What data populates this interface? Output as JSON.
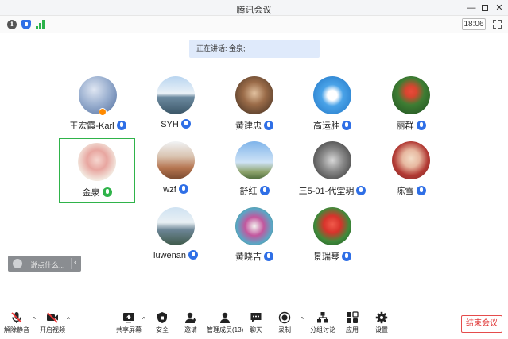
{
  "window": {
    "title": "腾讯会议",
    "minimize_glyph": "—",
    "close_glyph": "✕"
  },
  "status": {
    "info_glyph": "i",
    "time": "18:06",
    "icons": [
      "info-icon",
      "shield-icon",
      "signal-icon",
      "fullscreen-icon"
    ],
    "signal_color": "#2bb34a",
    "shield_color": "#2f6fe6"
  },
  "speaking": {
    "text": "正在讲话: 金泉;"
  },
  "participants": [
    {
      "name": "王宏霞-Karl",
      "mic": "blue",
      "host": true
    },
    {
      "name": "SYH",
      "mic": "blue"
    },
    {
      "name": "黄建忠",
      "mic": "blue"
    },
    {
      "name": "高运胜",
      "mic": "blue"
    },
    {
      "name": "丽群",
      "mic": "blue"
    },
    {
      "name": "金泉",
      "mic": "green",
      "speaking": true
    },
    {
      "name": "wzf",
      "mic": "blue"
    },
    {
      "name": "舒红",
      "mic": "blue"
    },
    {
      "name": "三5-01-代堂玥",
      "mic": "blue"
    },
    {
      "name": "陈雪",
      "mic": "blue"
    },
    {
      "name": "luwenan",
      "mic": "blue"
    },
    {
      "name": "黄晓吉",
      "mic": "blue"
    },
    {
      "name": "景瑞琴",
      "mic": "blue"
    }
  ],
  "chat": {
    "placeholder": "说点什么...",
    "collapse_glyph": "‹"
  },
  "toolbar": {
    "caret_glyph": "^",
    "unmute": "解除静音",
    "start_video": "开启视频",
    "share_screen": "共享屏幕",
    "security": "安全",
    "invite": "邀请",
    "manage_members": "管理成员(13)",
    "chat": "聊天",
    "record": "录制",
    "breakout": "分组讨论",
    "apps": "应用",
    "settings": "设置",
    "end_meeting": "结束会议"
  },
  "colors": {
    "accent_blue": "#2f6fe6",
    "speaking_green": "#2fb34a",
    "end_red": "#e03a3a",
    "banner_bg": "#dfeafb"
  }
}
